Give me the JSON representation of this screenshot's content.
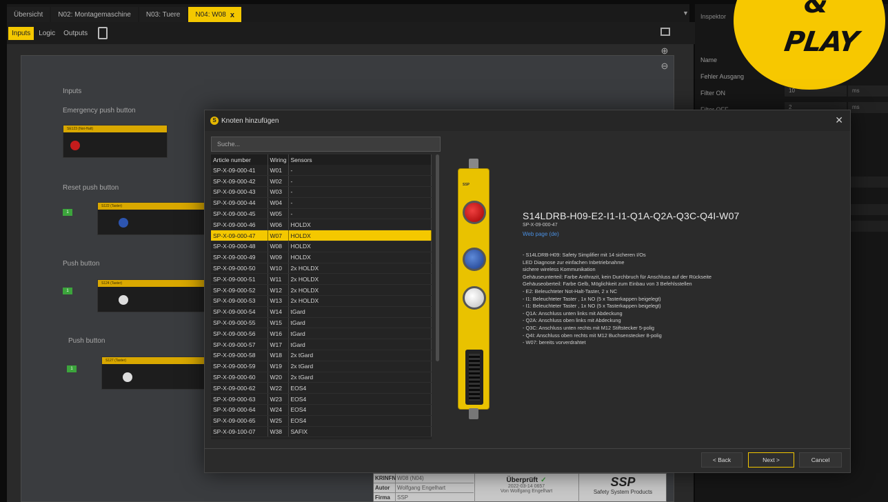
{
  "tabs": [
    {
      "label": "Übersicht"
    },
    {
      "label": "N02: Montagemaschine"
    },
    {
      "label": "N03: Tuere"
    },
    {
      "label": "N04: W08",
      "close": "x"
    }
  ],
  "subtabs": {
    "inputs": "Inputs",
    "logic": "Logic",
    "outputs": "Outputs"
  },
  "canvas": {
    "inputs_heading": "Inputs",
    "groups": [
      "Emergency push button",
      "Reset push button",
      "Push button",
      "Push button"
    ],
    "nodes": [
      "SE123 (Not-Halt)",
      "S122 (Taster)",
      "S124 (Taster)",
      "S127 (Taster)"
    ]
  },
  "inspector": {
    "title": "Inspektor",
    "rows": [
      {
        "label": "Name"
      },
      {
        "label": "Fehler Ausgang"
      },
      {
        "label": "Filter ON",
        "value": "10",
        "unit": "ms"
      },
      {
        "label": "Filter OFF",
        "value": "2",
        "unit": "ms"
      }
    ]
  },
  "titleblock": {
    "status": "Überprüft",
    "date": "2022-03-14 0657",
    "by": "Von Wolfgang Engelhart",
    "rows": [
      {
        "k": "KRINFN",
        "v": "W08 (N04)"
      },
      {
        "k": "Autor",
        "v": "Wolfgang Engelhart"
      },
      {
        "k": "Firma",
        "v": "SSP"
      }
    ],
    "logo": "SSP",
    "company": "Safety System Products"
  },
  "badge": {
    "line1": "&",
    "line2": "PLAY"
  },
  "modal": {
    "title": "Knoten hinzufügen",
    "close": "✕",
    "search_placeholder": "Suche...",
    "columns": [
      "Article number",
      "Wiring",
      "Sensors"
    ],
    "rows": [
      [
        "SP-X-09-000-41",
        "W01",
        "-"
      ],
      [
        "SP-X-09-000-42",
        "W02",
        "-"
      ],
      [
        "SP-X-09-000-43",
        "W03",
        "-"
      ],
      [
        "SP-X-09-000-44",
        "W04",
        "-"
      ],
      [
        "SP-X-09-000-45",
        "W05",
        "-"
      ],
      [
        "SP-X-09-000-46",
        "W06",
        "HOLDX"
      ],
      [
        "SP-X-09-000-47",
        "W07",
        "HOLDX"
      ],
      [
        "SP-X-09-000-48",
        "W08",
        "HOLDX"
      ],
      [
        "SP-X-09-000-49",
        "W09",
        "HOLDX"
      ],
      [
        "SP-X-09-000-50",
        "W10",
        "2x HOLDX"
      ],
      [
        "SP-X-09-000-51",
        "W11",
        "2x HOLDX"
      ],
      [
        "SP-X-09-000-52",
        "W12",
        "2x HOLDX"
      ],
      [
        "SP-X-09-000-53",
        "W13",
        "2x HOLDX"
      ],
      [
        "SP-X-09-000-54",
        "W14",
        "tGard"
      ],
      [
        "SP-X-09-000-55",
        "W15",
        "tGard"
      ],
      [
        "SP-X-09-000-56",
        "W16",
        "tGard"
      ],
      [
        "SP-X-09-000-57",
        "W17",
        "tGard"
      ],
      [
        "SP-X-09-000-58",
        "W18",
        "2x tGard"
      ],
      [
        "SP-X-09-000-59",
        "W19",
        "2x tGard"
      ],
      [
        "SP-X-09-000-60",
        "W20",
        "2x tGard"
      ],
      [
        "SP-X-09-000-62",
        "W22",
        "EOS4"
      ],
      [
        "SP-X-09-000-63",
        "W23",
        "EOS4"
      ],
      [
        "SP-X-09-000-64",
        "W24",
        "EOS4"
      ],
      [
        "SP-X-09-000-65",
        "W25",
        "EOS4"
      ],
      [
        "SP-X-09-100-07",
        "W38",
        "SAFIX"
      ]
    ],
    "selected_index": 6,
    "preview": {
      "name": "S14LDRB-H09-E2-I1-I1-Q1A-Q2A-Q3C-Q4I-W07",
      "article": "SP-X-09-000-47",
      "link": "Web page (de)",
      "description": [
        "- S14LDRB-H09: Safety Simplifier mit 14 sicheren I/Os",
        "  LED Diagnose zur einfachen Inbetriebnahme",
        "  sichere wireless Kommunikation",
        "  Gehäuseunterteil: Farbe Anthrazit, kein Durchbruch für Anschluss auf der Rückseite",
        "  Gehäuseoberteil: Farbe Gelb, Möglichkeit zum Einbau von 3 Befehlsstellen",
        "- E2: Beleuchteter Not-Halt-Taster, 2 x NC",
        "- I1: Beleuchteter Taster , 1x NO (5 x Tasterkappen beigelegt)",
        "- I1: Beleuchteter Taster , 1x NO (5 x Tasterkappen beigelegt)",
        "- Q1A: Anschluss unten links mit Abdeckung",
        "- Q2A: Anschluss oben links mit Abdeckung",
        "- Q3C: Anschluss unten rechts mit M12 Stiftstecker 5-polig",
        "- Q4I: Anschluss oben rechts mit M12 Buchsenstecker 8-polig",
        "- W07: bereits vorverdrahtet"
      ]
    },
    "buttons": {
      "back": "< Back",
      "next": "Next >",
      "cancel": "Cancel"
    }
  }
}
